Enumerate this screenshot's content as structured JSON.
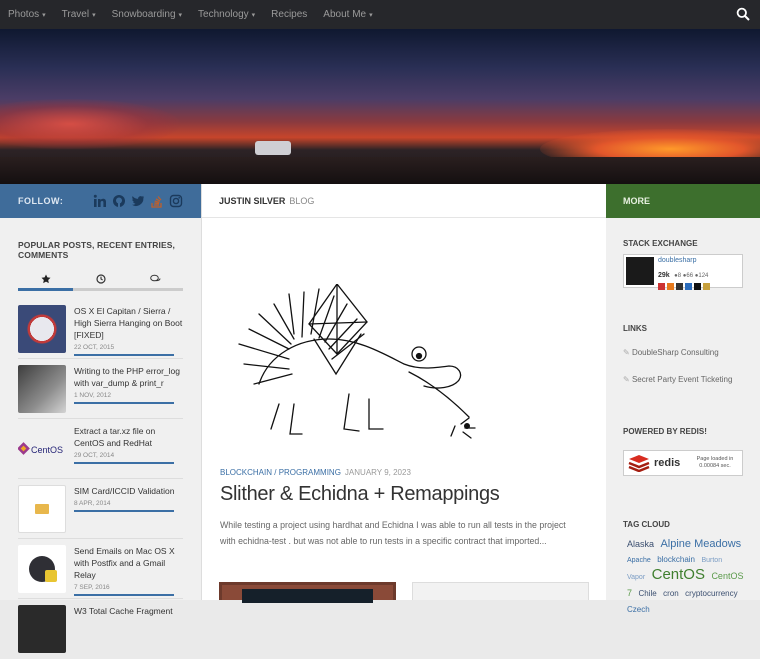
{
  "nav": {
    "items": [
      {
        "label": "Photos",
        "dropdown": true
      },
      {
        "label": "Travel",
        "dropdown": true
      },
      {
        "label": "Snowboarding",
        "dropdown": true
      },
      {
        "label": "Technology",
        "dropdown": true
      },
      {
        "label": "Recipes",
        "dropdown": false
      },
      {
        "label": "About Me",
        "dropdown": true
      }
    ],
    "search_icon": "search-icon"
  },
  "left": {
    "follow_label": "FOLLOW:",
    "social": [
      "linkedin-icon",
      "github-icon",
      "twitter-icon",
      "stackoverflow-icon",
      "instagram-icon"
    ],
    "section_title": "POPULAR POSTS, RECENT ENTRIES, COMMENTS",
    "tabs": [
      "star-icon",
      "clock-icon",
      "comments-icon"
    ],
    "posts": [
      {
        "title": "OS X El Capitan / Sierra / High Sierra Hanging on Boot [FIXED]",
        "date": "22 OCT, 2015"
      },
      {
        "title": "Writing to the PHP error_log with var_dump & print_r",
        "date": "1 NOV, 2012"
      },
      {
        "title": "Extract a tar.xz file on CentOS and RedHat",
        "date": "29 OCT, 2014"
      },
      {
        "title": "SIM Card/ICCID Validation",
        "date": "8 APR, 2014"
      },
      {
        "title": "Send Emails on Mac OS X with Postfix and a Gmail Relay",
        "date": "7 SEP, 2016"
      },
      {
        "title": "W3 Total Cache Fragment",
        "date": ""
      }
    ]
  },
  "main": {
    "brand": "JUSTIN SILVER",
    "brand_suffix": "BLOG",
    "category_1": "BLOCKCHAIN",
    "category_sep": " / ",
    "category_2": "PROGRAMMING",
    "date": "JANUARY 9, 2023",
    "headline": "Slither & Echidna + Remappings",
    "excerpt": "While testing a project using hardhat and Echidna I was able to run all tests in the project with echidna-test . but was not able to run tests in a specific contract that imported..."
  },
  "right": {
    "more_label": "MORE",
    "stack_title": "STACK EXCHANGE",
    "se_name": "doublesharp",
    "se_rep": "29k",
    "se_badges": "●8 ●66 ●124",
    "links_title": "LINKS",
    "links": [
      "DoubleSharp Consulting",
      "Secret Party Event Ticketing"
    ],
    "redis_title": "POWERED BY REDIS!",
    "redis_word": "redis",
    "redis_note": "Page loaded in 0.00084 sec.",
    "cloud_title": "TAG CLOUD",
    "tags": [
      {
        "t": "Alaska",
        "s": 9,
        "c": "#3b4f70"
      },
      {
        "t": "Alpine Meadows",
        "s": 11,
        "c": "#3b6fa5"
      },
      {
        "t": "Apache",
        "s": 7,
        "c": "#3b6fa5"
      },
      {
        "t": "blockchain",
        "s": 8,
        "c": "#3b6fa5"
      },
      {
        "t": "Burton",
        "s": 7,
        "c": "#7a9cc4"
      },
      {
        "t": "Vapor",
        "s": 7,
        "c": "#7a9cc4"
      },
      {
        "t": "CentOS",
        "s": 15,
        "c": "#3f7f2f"
      },
      {
        "t": "CentOS 7",
        "s": 9,
        "c": "#5a9a4a"
      },
      {
        "t": "Chile",
        "s": 8,
        "c": "#3b4f70"
      },
      {
        "t": "cron",
        "s": 8,
        "c": "#3b4f70"
      },
      {
        "t": "cryptocurrency",
        "s": 8,
        "c": "#3b4f70"
      },
      {
        "t": "Czech",
        "s": 8,
        "c": "#3b6fa5"
      }
    ]
  }
}
